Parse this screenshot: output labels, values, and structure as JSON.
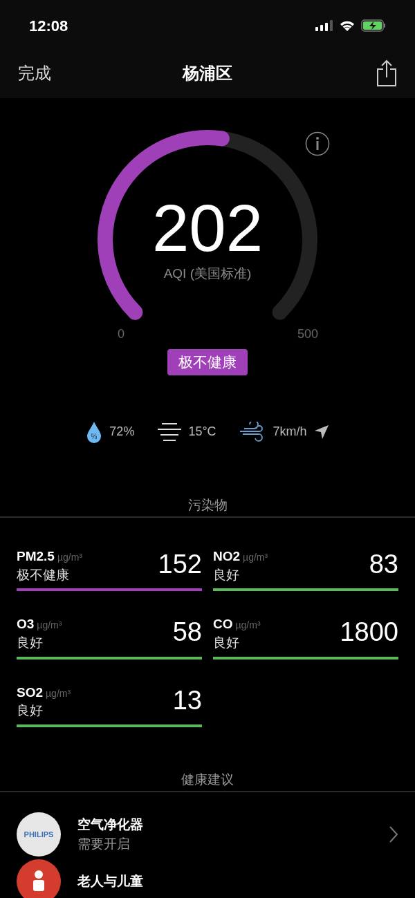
{
  "status_bar": {
    "time": "12:08"
  },
  "nav": {
    "back": "完成",
    "title": "杨浦区"
  },
  "gauge": {
    "value": "202",
    "label": "AQI (美国标准)",
    "min": "0",
    "max": "500",
    "color": "#a040b8",
    "category": "极不健康"
  },
  "weather": {
    "humidity_icon_symbol": "%",
    "humidity": "72%",
    "temperature": "15°C",
    "wind": "7km/h"
  },
  "pollutants_section": {
    "title": "污染物",
    "items": [
      {
        "name": "PM2.5",
        "unit": "µg/m³",
        "status": "极不健康",
        "value": "152",
        "color": "#a040b8"
      },
      {
        "name": "NO2",
        "unit": "µg/m³",
        "status": "良好",
        "value": "83",
        "color": "#5cb85c"
      },
      {
        "name": "O3",
        "unit": "µg/m³",
        "status": "良好",
        "value": "58",
        "color": "#5cb85c"
      },
      {
        "name": "CO",
        "unit": "µg/m³",
        "status": "良好",
        "value": "1800",
        "color": "#5cb85c"
      },
      {
        "name": "SO2",
        "unit": "µg/m³",
        "status": "良好",
        "value": "13",
        "color": "#5cb85c"
      }
    ]
  },
  "health_section": {
    "title": "健康建议",
    "items": [
      {
        "kind": "logo",
        "logo": "PHILIPS",
        "title": "空气净化器",
        "subtitle": "需要开启"
      },
      {
        "kind": "person",
        "title": "老人与儿童"
      }
    ]
  }
}
